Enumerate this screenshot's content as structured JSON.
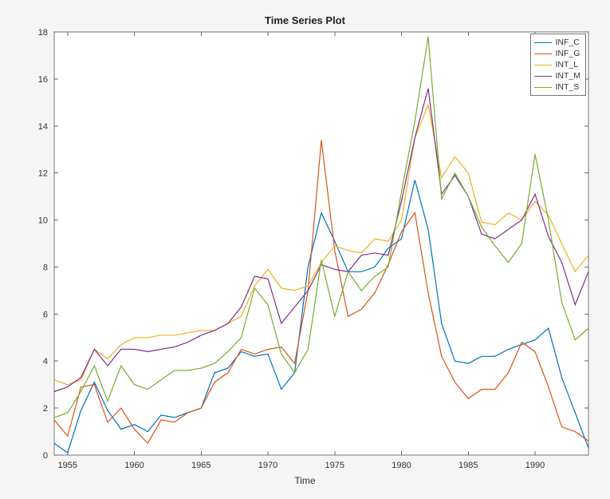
{
  "chart_data": {
    "type": "line",
    "title": "Time Series Plot",
    "xlabel": "Time",
    "ylabel": "",
    "xlim": [
      1954,
      1994
    ],
    "ylim": [
      0,
      18
    ],
    "xticks": [
      1955,
      1960,
      1965,
      1970,
      1975,
      1980,
      1985,
      1990
    ],
    "yticks": [
      0,
      2,
      4,
      6,
      8,
      10,
      12,
      14,
      16,
      18
    ],
    "x": [
      1954,
      1955,
      1956,
      1957,
      1958,
      1959,
      1960,
      1961,
      1962,
      1963,
      1964,
      1965,
      1966,
      1967,
      1968,
      1969,
      1970,
      1971,
      1972,
      1973,
      1974,
      1975,
      1976,
      1977,
      1978,
      1979,
      1980,
      1981,
      1982,
      1983,
      1984,
      1985,
      1986,
      1987,
      1988,
      1989,
      1990,
      1991,
      1992,
      1993,
      1994
    ],
    "series": [
      {
        "name": "INF_C",
        "color": "#0072BD",
        "values": [
          0.5,
          0.1,
          1.9,
          3.1,
          1.9,
          1.1,
          1.3,
          1.0,
          1.7,
          1.6,
          1.8,
          2.0,
          3.5,
          3.7,
          4.4,
          4.2,
          4.3,
          2.8,
          3.5,
          8.0,
          10.3,
          9.1,
          7.8,
          7.8,
          8.0,
          8.8,
          9.2,
          11.7,
          9.6,
          5.6,
          4.0,
          3.9,
          4.2,
          4.2,
          4.5,
          4.7,
          4.9,
          5.4,
          3.3,
          1.8,
          0.3
        ]
      },
      {
        "name": "INF_G",
        "color": "#D95319",
        "values": [
          1.5,
          0.8,
          2.9,
          3.0,
          1.4,
          2.0,
          1.1,
          0.5,
          1.5,
          1.4,
          1.8,
          2.0,
          3.1,
          3.5,
          4.5,
          4.3,
          4.5,
          4.6,
          3.9,
          7.0,
          13.4,
          8.7,
          5.9,
          6.2,
          6.9,
          8.1,
          9.5,
          10.3,
          6.9,
          4.2,
          3.1,
          2.4,
          2.8,
          2.8,
          3.5,
          4.8,
          4.4,
          2.9,
          1.2,
          1.0,
          0.6
        ]
      },
      {
        "name": "INT_L",
        "color": "#EDB120",
        "values": [
          3.2,
          3.0,
          3.2,
          4.5,
          4.1,
          4.7,
          5.0,
          5.0,
          5.1,
          5.1,
          5.2,
          5.3,
          5.3,
          5.6,
          5.9,
          7.2,
          7.9,
          7.1,
          7.0,
          7.2,
          8.2,
          8.9,
          8.7,
          8.6,
          9.2,
          9.1,
          10.0,
          13.5,
          14.9,
          11.8,
          12.7,
          12.0,
          9.9,
          9.8,
          10.3,
          10.0,
          10.8,
          10.2,
          9.0,
          7.8,
          8.5
        ]
      },
      {
        "name": "INT_M",
        "color": "#7E2F8E",
        "values": [
          2.7,
          2.9,
          3.3,
          4.5,
          3.8,
          4.5,
          4.5,
          4.4,
          4.5,
          4.6,
          4.8,
          5.1,
          5.3,
          5.6,
          6.3,
          7.6,
          7.5,
          5.6,
          6.3,
          7.0,
          8.1,
          7.9,
          7.8,
          8.5,
          8.6,
          8.5,
          10.8,
          13.5,
          15.6,
          11.1,
          11.9,
          11.0,
          9.4,
          9.2,
          9.6,
          10.0,
          11.1,
          9.3,
          8.2,
          6.4,
          7.8
        ]
      },
      {
        "name": "INT_S",
        "color": "#77AC30",
        "values": [
          1.6,
          1.8,
          2.7,
          3.8,
          2.3,
          3.8,
          3.0,
          2.8,
          3.2,
          3.6,
          3.6,
          3.7,
          3.9,
          4.4,
          5.0,
          7.1,
          6.4,
          4.3,
          3.5,
          4.5,
          8.3,
          5.9,
          7.8,
          7.0,
          7.6,
          8.0,
          11.2,
          14.2,
          17.8,
          10.9,
          12.0,
          11.0,
          9.7,
          8.9,
          8.2,
          9.0,
          12.8,
          10.0,
          6.5,
          4.9,
          5.4
        ]
      }
    ],
    "legend_position": "northeast"
  }
}
